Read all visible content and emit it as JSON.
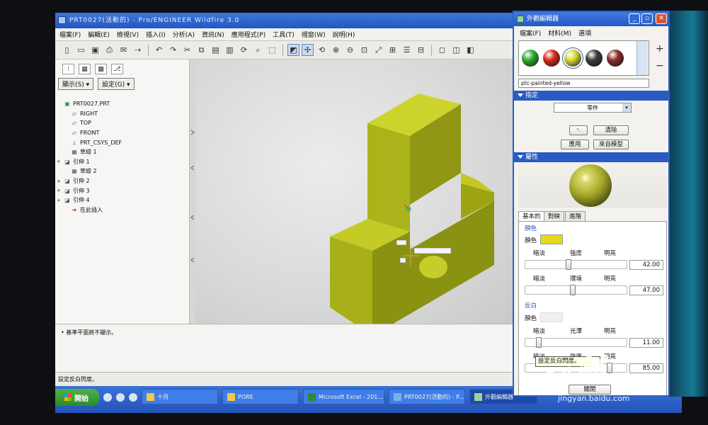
{
  "window": {
    "title": "PRT0027(活動的) - Pro/ENGINEER Wildfire 3.0"
  },
  "menubar": [
    "檔案(F)",
    "編輯(E)",
    "檢視(V)",
    "插入(I)",
    "分析(A)",
    "資訊(N)",
    "應用程式(P)",
    "工具(T)",
    "視窗(W)",
    "說明(H)"
  ],
  "navigator": {
    "show_button": "顯示(S) ▾",
    "settings_button": "設定(G) ▾",
    "tree": [
      {
        "label": "PRT0027.PRT",
        "icon": "part-icon",
        "expander": ""
      },
      {
        "label": "RIGHT",
        "icon": "datum-plane-icon",
        "expander": ""
      },
      {
        "label": "TOP",
        "icon": "datum-plane-icon",
        "expander": ""
      },
      {
        "label": "FRONT",
        "icon": "datum-plane-icon",
        "expander": ""
      },
      {
        "label": "PRT_CSYS_DEF",
        "icon": "coordinate-system-icon",
        "expander": ""
      },
      {
        "label": "草繪 1",
        "icon": "sketch-icon",
        "expander": ""
      },
      {
        "label": "引伸 1",
        "icon": "extrude-icon",
        "expander": "+"
      },
      {
        "label": "草繪 2",
        "icon": "sketch-icon",
        "expander": ""
      },
      {
        "label": "引伸 2",
        "icon": "extrude-icon",
        "expander": "+"
      },
      {
        "label": "引伸 3",
        "icon": "extrude-icon",
        "expander": "+"
      },
      {
        "label": "引伸 4",
        "icon": "extrude-icon",
        "expander": "+"
      },
      {
        "label": "在此插入",
        "icon": "insert-here-arrow-icon",
        "expander": ""
      }
    ]
  },
  "messages": {
    "line1": "• 基準平面將不顯示。"
  },
  "statusbar": {
    "text": "設定反白閃度。"
  },
  "taskbar": {
    "start": "開始",
    "items": [
      "十月",
      "PORE",
      "Microsoft Excel - 201...",
      "PRT0027(活動的) - P...",
      "外觀編輯器"
    ]
  },
  "dialog": {
    "title": "外觀編輯器",
    "menu": [
      "檔案(F)",
      "材料(M)",
      "選項"
    ],
    "swatch_colors": [
      "#2fae2f",
      "#d62a1e",
      "#d6d63a",
      "#3c3c3c",
      "#8a2e2a"
    ],
    "selected_appearance": "ptc-painted-yellow",
    "assign": {
      "section_label": "指定",
      "combo_value": "零件",
      "clear_button": "清除",
      "apply_button": "應用",
      "from_model_button": "來自模型"
    },
    "properties": {
      "section_label": "屬性",
      "tabs": [
        "基本的",
        "對映",
        "進階"
      ],
      "color_group": "顏色",
      "color_label": "顏色",
      "color_value": "#e6d81b",
      "intensity": {
        "dim": "暗淡",
        "label": "強度",
        "bright": "明亮",
        "value": "42.00",
        "fraction": 0.42
      },
      "ambient": {
        "dim": "暗淡",
        "label": "環境",
        "bright": "明亮",
        "value": "47.00",
        "fraction": 0.47
      },
      "highlight_group": "反白",
      "highlight_color_label": "顏色",
      "shininess": {
        "dim": "暗淡",
        "label": "光澤",
        "bright": "明亮",
        "value": "11.00",
        "fraction": 0.11
      },
      "highlight_intensity": {
        "dim": "暗淡",
        "label": "強度",
        "bright": "明亮",
        "value": "85.00",
        "fraction": 0.85
      },
      "tooltip": "設定反白閃度。",
      "close_button": "關閉"
    }
  },
  "watermark": {
    "brand": "Bai 經驗",
    "url": "jingyan.baidu.com"
  },
  "colors": {
    "part_yellow": "#b7bf1b",
    "title_blue": "#2558c6"
  }
}
